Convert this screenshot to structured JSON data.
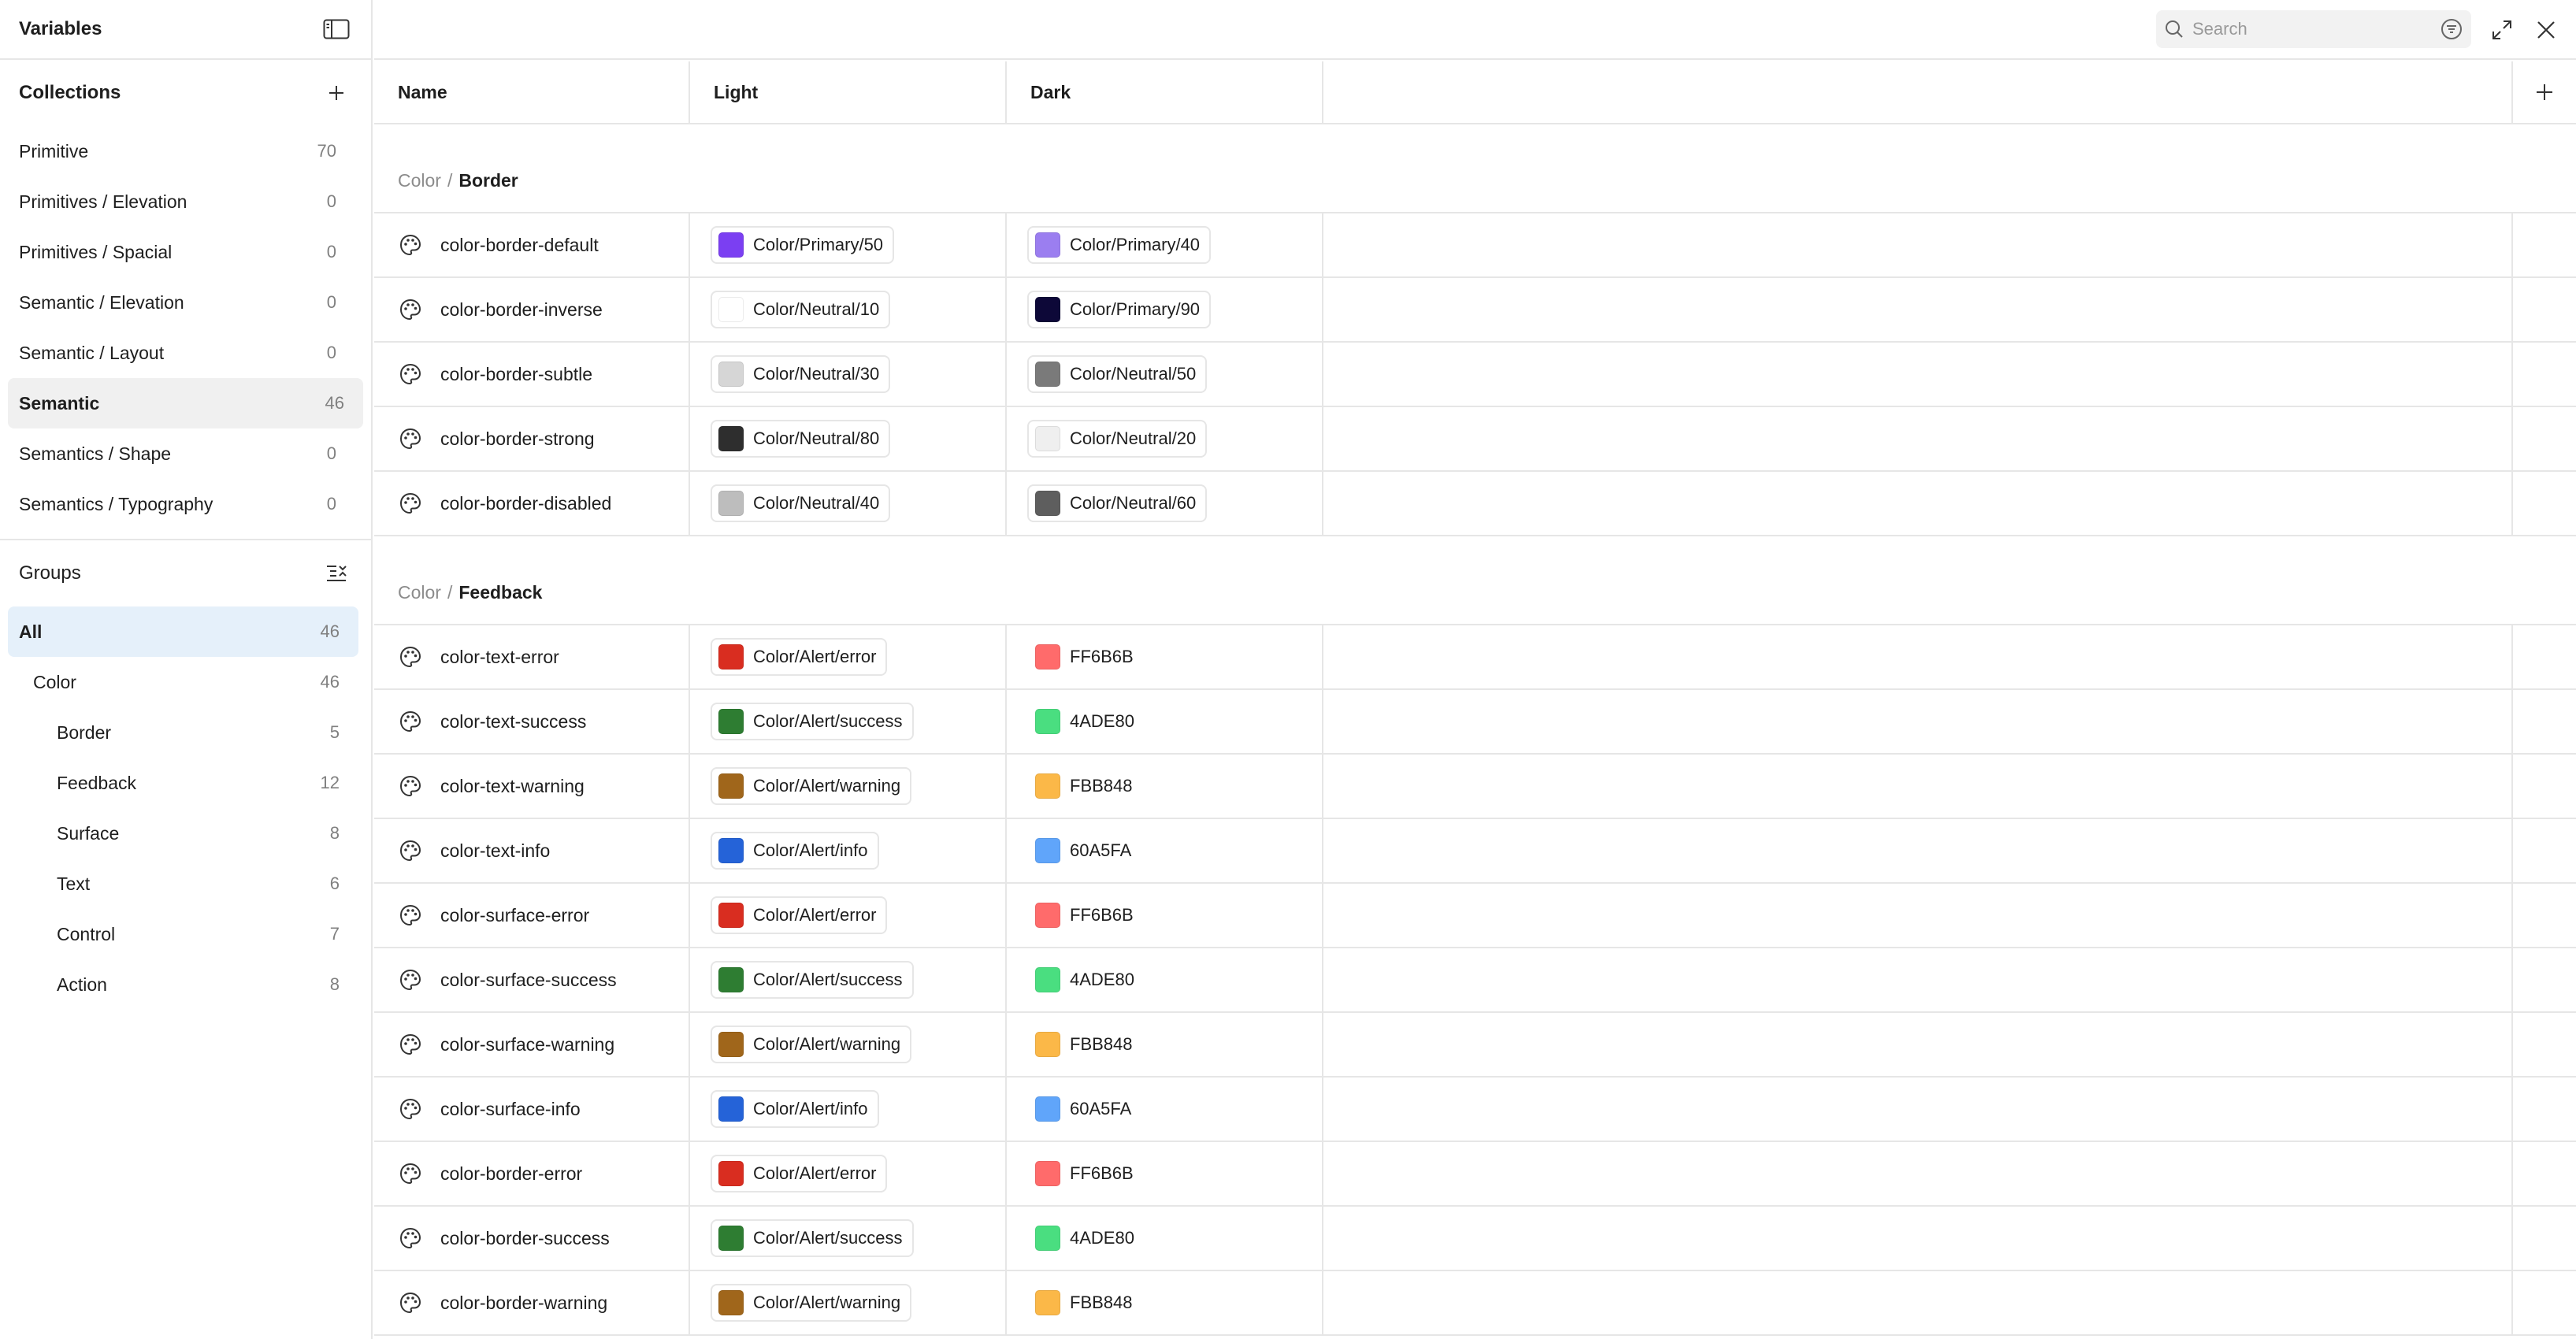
{
  "sidebar": {
    "title": "Variables",
    "collections_title": "Collections",
    "collections": [
      {
        "label": "Primitive",
        "count": "70"
      },
      {
        "label": "Primitives / Elevation",
        "count": "0"
      },
      {
        "label": "Primitives / Spacial",
        "count": "0"
      },
      {
        "label": "Semantic / Elevation",
        "count": "0"
      },
      {
        "label": "Semantic / Layout",
        "count": "0"
      },
      {
        "label": "Semantic",
        "count": "46"
      },
      {
        "label": "Semantics / Shape",
        "count": "0"
      },
      {
        "label": "Semantics / Typography",
        "count": "0"
      }
    ],
    "groups_title": "Groups",
    "groups": [
      {
        "label": "All",
        "count": "46"
      },
      {
        "label": "Color",
        "count": "46"
      },
      {
        "label": "Border",
        "count": "5"
      },
      {
        "label": "Feedback",
        "count": "12"
      },
      {
        "label": "Surface",
        "count": "8"
      },
      {
        "label": "Text",
        "count": "6"
      },
      {
        "label": "Control",
        "count": "7"
      },
      {
        "label": "Action",
        "count": "8"
      }
    ]
  },
  "search": {
    "placeholder": "Search"
  },
  "table": {
    "columns": {
      "name": "Name",
      "light": "Light",
      "dark": "Dark"
    },
    "sections": [
      {
        "prefix": "Color",
        "separator": "/",
        "name": "Border",
        "rows": [
          {
            "name": "color-border-default",
            "light": {
              "label": "Color/Primary/50",
              "color": "#7b3ff2"
            },
            "dark": {
              "label": "Color/Primary/40",
              "color": "#9b7ef0",
              "alias": true
            }
          },
          {
            "name": "color-border-inverse",
            "light": {
              "label": "Color/Neutral/10",
              "color": "#ffffff"
            },
            "dark": {
              "label": "Color/Primary/90",
              "color": "#0d0838",
              "alias": true
            }
          },
          {
            "name": "color-border-subtle",
            "light": {
              "label": "Color/Neutral/30",
              "color": "#d6d6d6"
            },
            "dark": {
              "label": "Color/Neutral/50",
              "color": "#7a7a7a",
              "alias": true
            }
          },
          {
            "name": "color-border-strong",
            "light": {
              "label": "Color/Neutral/80",
              "color": "#2e2e2e"
            },
            "dark": {
              "label": "Color/Neutral/20",
              "color": "#efefef",
              "alias": true
            }
          },
          {
            "name": "color-border-disabled",
            "light": {
              "label": "Color/Neutral/40",
              "color": "#bdbdbd"
            },
            "dark": {
              "label": "Color/Neutral/60",
              "color": "#5e5e5e",
              "alias": true
            }
          }
        ]
      },
      {
        "prefix": "Color",
        "separator": "/",
        "name": "Feedback",
        "rows": [
          {
            "name": "color-text-error",
            "light": {
              "label": "Color/Alert/error",
              "color": "#d92d20"
            },
            "dark": {
              "label": "FF6B6B",
              "color": "#ff6b6b",
              "alias": false
            }
          },
          {
            "name": "color-text-success",
            "light": {
              "label": "Color/Alert/success",
              "color": "#2e7d32"
            },
            "dark": {
              "label": "4ADE80",
              "color": "#4ade80",
              "alias": false
            }
          },
          {
            "name": "color-text-warning",
            "light": {
              "label": "Color/Alert/warning",
              "color": "#a0661b"
            },
            "dark": {
              "label": "FBB848",
              "color": "#fbb848",
              "alias": false
            }
          },
          {
            "name": "color-text-info",
            "light": {
              "label": "Color/Alert/info",
              "color": "#2563d8"
            },
            "dark": {
              "label": "60A5FA",
              "color": "#60a5fa",
              "alias": false
            }
          },
          {
            "name": "color-surface-error",
            "light": {
              "label": "Color/Alert/error",
              "color": "#d92d20"
            },
            "dark": {
              "label": "FF6B6B",
              "color": "#ff6b6b",
              "alias": false
            }
          },
          {
            "name": "color-surface-success",
            "light": {
              "label": "Color/Alert/success",
              "color": "#2e7d32"
            },
            "dark": {
              "label": "4ADE80",
              "color": "#4ade80",
              "alias": false
            }
          },
          {
            "name": "color-surface-warning",
            "light": {
              "label": "Color/Alert/warning",
              "color": "#a0661b"
            },
            "dark": {
              "label": "FBB848",
              "color": "#fbb848",
              "alias": false
            }
          },
          {
            "name": "color-surface-info",
            "light": {
              "label": "Color/Alert/info",
              "color": "#2563d8"
            },
            "dark": {
              "label": "60A5FA",
              "color": "#60a5fa",
              "alias": false
            }
          },
          {
            "name": "color-border-error",
            "light": {
              "label": "Color/Alert/error",
              "color": "#d92d20"
            },
            "dark": {
              "label": "FF6B6B",
              "color": "#ff6b6b",
              "alias": false
            }
          },
          {
            "name": "color-border-success",
            "light": {
              "label": "Color/Alert/success",
              "color": "#2e7d32"
            },
            "dark": {
              "label": "4ADE80",
              "color": "#4ade80",
              "alias": false
            }
          },
          {
            "name": "color-border-warning",
            "light": {
              "label": "Color/Alert/warning",
              "color": "#a0661b"
            },
            "dark": {
              "label": "FBB848",
              "color": "#fbb848",
              "alias": false
            }
          }
        ]
      }
    ]
  },
  "icons": {
    "sidebar_toggle": "sidebar-toggle-icon",
    "add_collection": "plus-icon",
    "groups_menu": "collapse-list-icon",
    "search": "search-icon",
    "filter": "filter-icon",
    "expand": "expand-icon",
    "close": "close-icon",
    "add_mode": "plus-icon",
    "variable": "palette-icon"
  },
  "colors": {
    "selected_group_bg": "#e5f0fa",
    "selected_collection_bg": "#f0f0f0",
    "border": "#e6e6e6"
  },
  "state": {
    "selected_collection": "Semantic",
    "selected_group": "All"
  }
}
